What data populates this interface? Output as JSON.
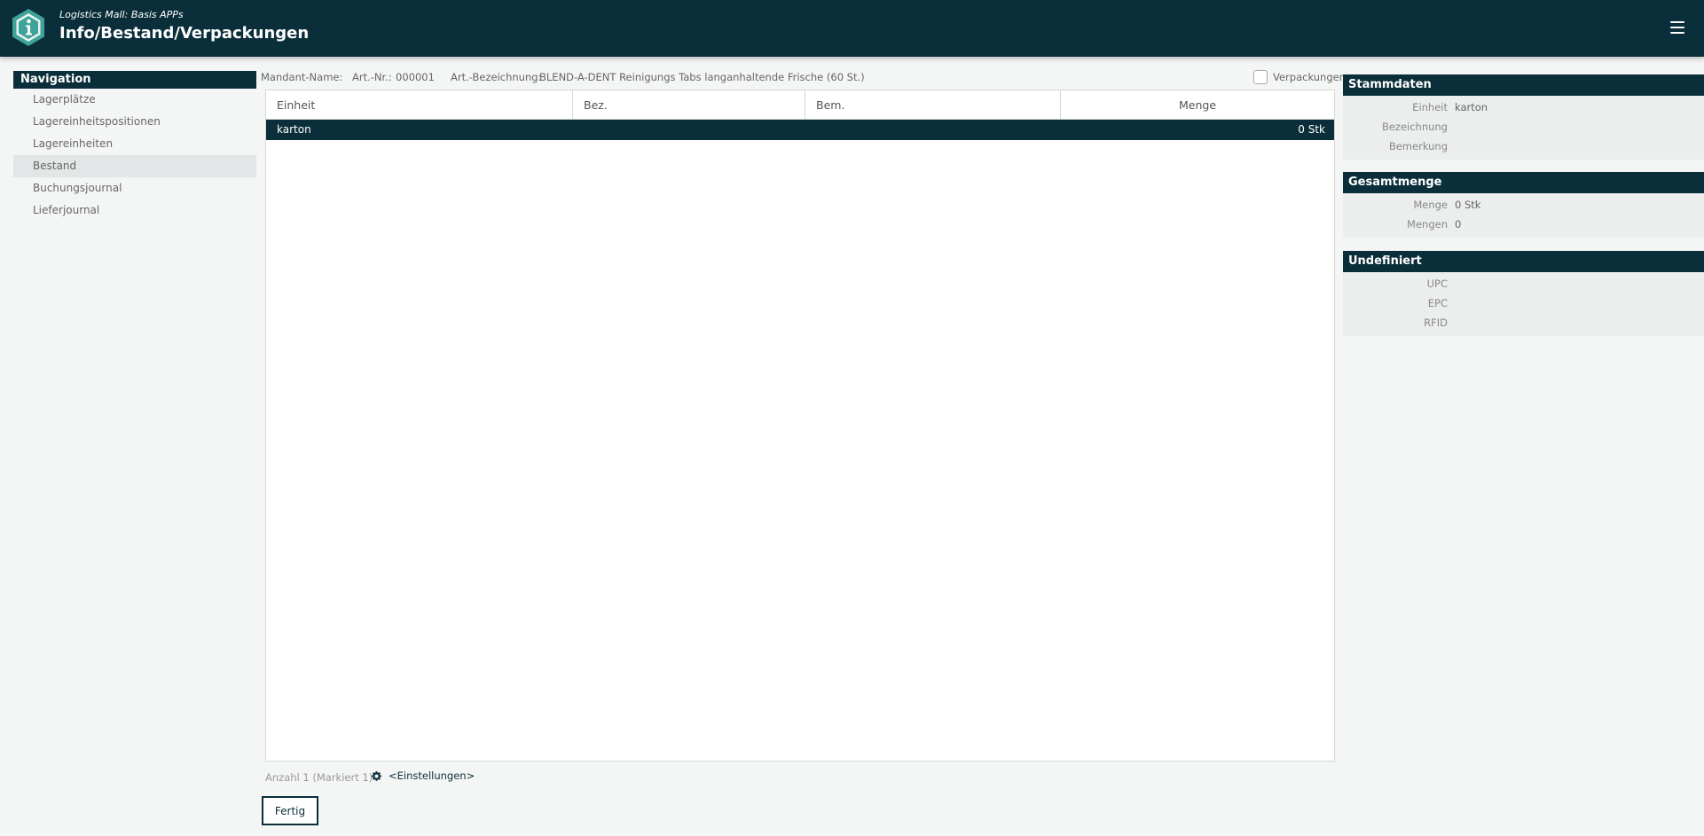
{
  "header": {
    "subtitle": "Logistics Mall: Basis APPs",
    "title": "Info/Bestand/Verpackungen"
  },
  "nav": {
    "title": "Navigation",
    "items": [
      {
        "label": "Lagerplätze"
      },
      {
        "label": "Lagereinheitspositionen"
      },
      {
        "label": "Lagereinheiten"
      },
      {
        "label": "Bestand",
        "active": true
      },
      {
        "label": "Buchungsjournal"
      },
      {
        "label": "Lieferjournal"
      }
    ]
  },
  "info": {
    "mandant_label": "Mandant-Name:",
    "mandant_value": "",
    "artnr_label": "Art.-Nr.:",
    "artnr_value": "000001",
    "artbez_label": "Art.-Bezeichnung:",
    "artbez_value": "BLEND-A-DENT Reinigungs Tabs langanhaltende Frische (60 St.)",
    "packaging_checkbox_label": "Verpackungen",
    "packaging_checked": false
  },
  "grid": {
    "columns": [
      "Einheit",
      "Bez.",
      "Bem.",
      "Menge"
    ],
    "rows": [
      {
        "einheit": "karton",
        "bez": "",
        "bem": "",
        "menge": "0 Stk",
        "selected": true
      }
    ]
  },
  "footer": {
    "count_text": "Anzahl 1 (Markiert 1)",
    "settings_label": "<Einstellungen>",
    "done_label": "Fertig"
  },
  "stammdaten": {
    "title": "Stammdaten",
    "fields": [
      {
        "label": "Einheit",
        "value": "karton"
      },
      {
        "label": "Bezeichnung",
        "value": ""
      },
      {
        "label": "Bemerkung",
        "value": ""
      }
    ]
  },
  "gesamtmenge": {
    "title": "Gesamtmenge",
    "fields": [
      {
        "label": "Menge",
        "value": "0 Stk"
      },
      {
        "label": "Mengen",
        "value": "0"
      }
    ]
  },
  "undefiniert": {
    "title": "Undefiniert",
    "fields": [
      {
        "label": "UPC",
        "value": ""
      },
      {
        "label": "EPC",
        "value": ""
      },
      {
        "label": "RFID",
        "value": ""
      }
    ]
  },
  "colors": {
    "primary": "#0b2f3a",
    "background": "#f4f5f5",
    "nav_active": "#e3e6e6"
  },
  "icons": {
    "logo": "info-hexagon-logo",
    "menu": "hamburger-menu-icon",
    "settings": "gear-icon"
  }
}
